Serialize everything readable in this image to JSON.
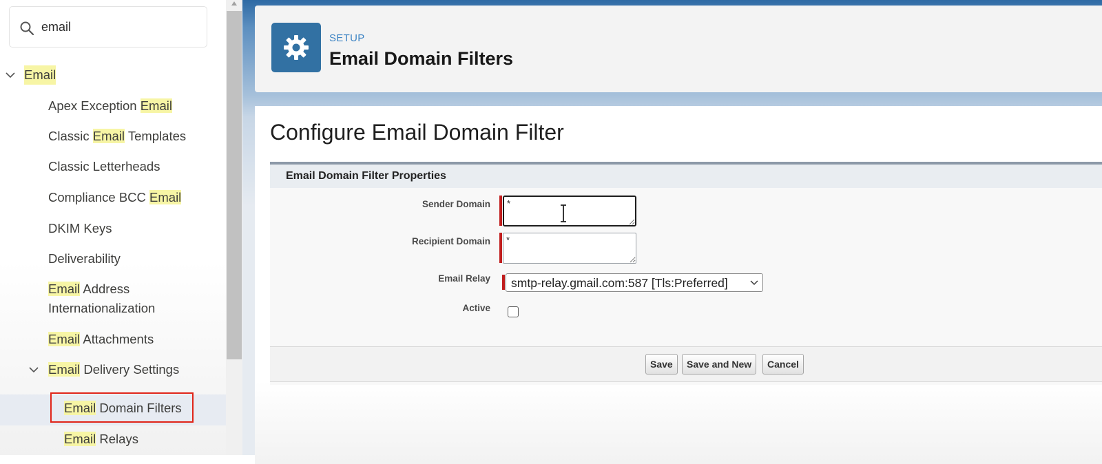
{
  "sidebar": {
    "search": {
      "value": "email",
      "placeholder": ""
    },
    "root_item": {
      "label": "Email",
      "highlight": "Email"
    },
    "items": [
      {
        "pre": "Apex Exception ",
        "hl": "Email",
        "post": ""
      },
      {
        "pre": "Classic ",
        "hl": "Email",
        "post": " Templates"
      },
      {
        "pre": "Classic Letterheads",
        "hl": "",
        "post": ""
      },
      {
        "pre": "Compliance BCC ",
        "hl": "Email",
        "post": ""
      },
      {
        "pre": "DKIM Keys",
        "hl": "",
        "post": ""
      },
      {
        "pre": "Deliverability",
        "hl": "",
        "post": ""
      },
      {
        "pre": "",
        "hl": "Email",
        "post": " Address"
      },
      {
        "pre": "Internationalization",
        "hl": "",
        "post": ""
      },
      {
        "pre": "",
        "hl": "Email",
        "post": " Attachments"
      }
    ],
    "delivery_settings": {
      "hl": "Email",
      "post": " Delivery Settings"
    },
    "sub_items": [
      {
        "hl": "Email",
        "post": " Domain Filters"
      },
      {
        "hl": "Email",
        "post": " Relays"
      }
    ]
  },
  "header": {
    "eyebrow": "SETUP",
    "title": "Email Domain Filters",
    "icon": "gear-icon"
  },
  "main": {
    "page_title": "Configure Email Domain Filter",
    "section_title": "Email Domain Filter Properties",
    "fields": {
      "sender_domain": {
        "label": "Sender Domain",
        "value": "*"
      },
      "recipient_domain": {
        "label": "Recipient Domain",
        "value": "*"
      },
      "email_relay": {
        "label": "Email Relay",
        "value": "smtp-relay.gmail.com:587 [Tls:Preferred]"
      },
      "active": {
        "label": "Active",
        "checked": false
      }
    },
    "buttons": {
      "save": "Save",
      "save_and_new": "Save and New",
      "cancel": "Cancel"
    }
  },
  "colors": {
    "highlight": "#f7f5a5",
    "required": "#c01d1d",
    "setup_icon_bg": "#3271a3",
    "annotation_box": "#e02418"
  }
}
